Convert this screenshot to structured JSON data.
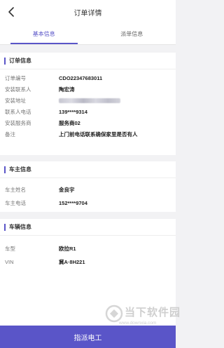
{
  "header": {
    "title": "订单详情"
  },
  "tabs": [
    {
      "label": "基本信息",
      "active": true
    },
    {
      "label": "派单信息",
      "active": false
    }
  ],
  "order_info": {
    "title": "订单信息",
    "rows": [
      {
        "label": "订单编号",
        "value": "CDO22347683011"
      },
      {
        "label": "安装联系人",
        "value": "陶宏涛"
      },
      {
        "label": "安装地址",
        "value": ""
      },
      {
        "label": "联系人电话",
        "value": "139****9314"
      },
      {
        "label": "安装服务商",
        "value": "服务商02"
      },
      {
        "label": "备注",
        "value": "上门前电话联系确保家里是否有人"
      }
    ]
  },
  "owner_info": {
    "title": "车主信息",
    "rows": [
      {
        "label": "车主姓名",
        "value": "金良宇"
      },
      {
        "label": "车主电话",
        "value": "152****9704"
      }
    ]
  },
  "vehicle_info": {
    "title": "车辆信息",
    "rows": [
      {
        "label": "车型",
        "value": "欧拉R1"
      },
      {
        "label": "VIN",
        "value": "冀A·8H221"
      }
    ]
  },
  "watermark": {
    "name": "当下软件园",
    "url": "www.downxia.com"
  },
  "action": {
    "label": "指派电工"
  },
  "colors": {
    "accent": "#5a55c8",
    "background": "#f2f2f4"
  }
}
